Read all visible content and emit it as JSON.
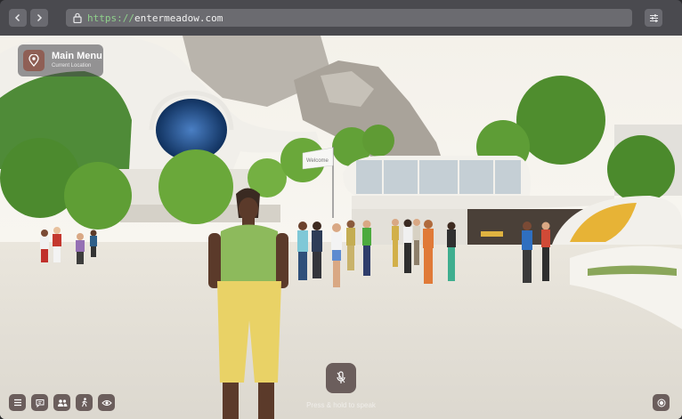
{
  "browser": {
    "url_scheme": "https://",
    "url_host": "entermeadow.com"
  },
  "overlay": {
    "main_menu_title": "Main Menu",
    "main_menu_subtitle": "Current Location",
    "mic_hint": "Press & hold to speak"
  },
  "scene": {
    "sign_text": "Welcome"
  },
  "icons": {
    "back": "chevron-left-icon",
    "forward": "chevron-right-icon",
    "lock": "lock-icon",
    "settings": "sliders-icon",
    "location": "location-pin-icon",
    "mic": "microphone-icon",
    "menu": "hamburger-menu-icon",
    "chat": "chat-icon",
    "people": "people-icon",
    "emote": "walking-figure-icon",
    "view": "eye-icon",
    "record": "record-icon"
  },
  "colors": {
    "chrome": "#4a4a4f",
    "url_bar": "#6b6b70",
    "url_scheme": "#8fd18b",
    "control_bg": "#6b5e5c",
    "pin_bg": "#8f5f55"
  }
}
